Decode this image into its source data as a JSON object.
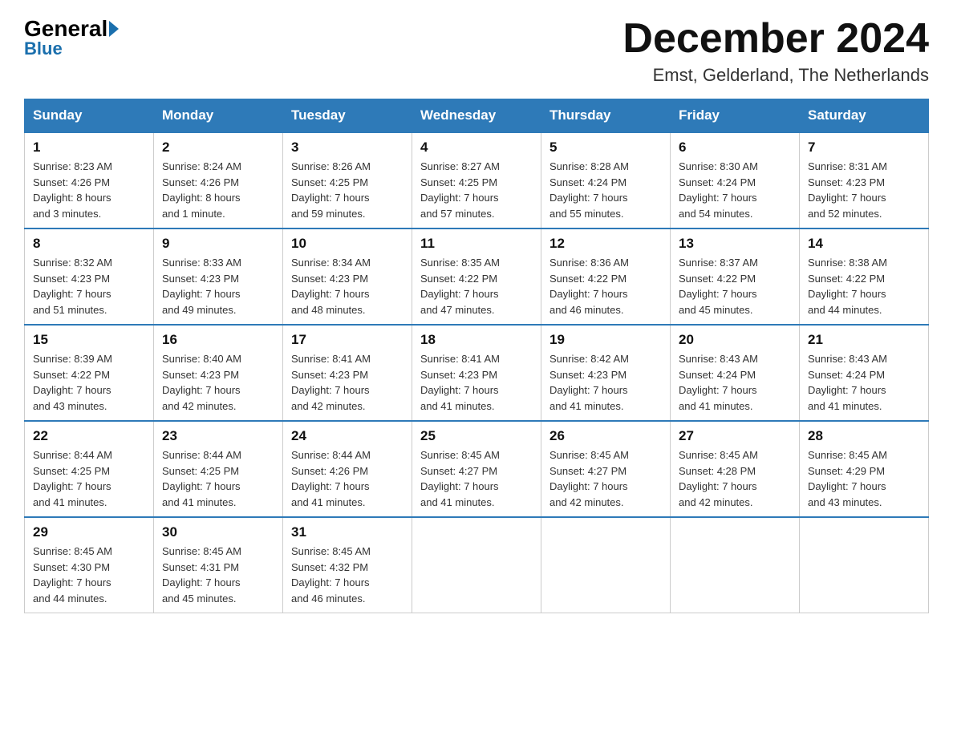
{
  "logo": {
    "general": "General",
    "blue": "Blue",
    "subtitle": "Blue"
  },
  "header": {
    "month": "December 2024",
    "location": "Emst, Gelderland, The Netherlands"
  },
  "days_of_week": [
    "Sunday",
    "Monday",
    "Tuesday",
    "Wednesday",
    "Thursday",
    "Friday",
    "Saturday"
  ],
  "weeks": [
    [
      {
        "num": "1",
        "sunrise": "8:23 AM",
        "sunset": "4:26 PM",
        "daylight": "8 hours and 3 minutes."
      },
      {
        "num": "2",
        "sunrise": "8:24 AM",
        "sunset": "4:26 PM",
        "daylight": "8 hours and 1 minute."
      },
      {
        "num": "3",
        "sunrise": "8:26 AM",
        "sunset": "4:25 PM",
        "daylight": "7 hours and 59 minutes."
      },
      {
        "num": "4",
        "sunrise": "8:27 AM",
        "sunset": "4:25 PM",
        "daylight": "7 hours and 57 minutes."
      },
      {
        "num": "5",
        "sunrise": "8:28 AM",
        "sunset": "4:24 PM",
        "daylight": "7 hours and 55 minutes."
      },
      {
        "num": "6",
        "sunrise": "8:30 AM",
        "sunset": "4:24 PM",
        "daylight": "7 hours and 54 minutes."
      },
      {
        "num": "7",
        "sunrise": "8:31 AM",
        "sunset": "4:23 PM",
        "daylight": "7 hours and 52 minutes."
      }
    ],
    [
      {
        "num": "8",
        "sunrise": "8:32 AM",
        "sunset": "4:23 PM",
        "daylight": "7 hours and 51 minutes."
      },
      {
        "num": "9",
        "sunrise": "8:33 AM",
        "sunset": "4:23 PM",
        "daylight": "7 hours and 49 minutes."
      },
      {
        "num": "10",
        "sunrise": "8:34 AM",
        "sunset": "4:23 PM",
        "daylight": "7 hours and 48 minutes."
      },
      {
        "num": "11",
        "sunrise": "8:35 AM",
        "sunset": "4:22 PM",
        "daylight": "7 hours and 47 minutes."
      },
      {
        "num": "12",
        "sunrise": "8:36 AM",
        "sunset": "4:22 PM",
        "daylight": "7 hours and 46 minutes."
      },
      {
        "num": "13",
        "sunrise": "8:37 AM",
        "sunset": "4:22 PM",
        "daylight": "7 hours and 45 minutes."
      },
      {
        "num": "14",
        "sunrise": "8:38 AM",
        "sunset": "4:22 PM",
        "daylight": "7 hours and 44 minutes."
      }
    ],
    [
      {
        "num": "15",
        "sunrise": "8:39 AM",
        "sunset": "4:22 PM",
        "daylight": "7 hours and 43 minutes."
      },
      {
        "num": "16",
        "sunrise": "8:40 AM",
        "sunset": "4:23 PM",
        "daylight": "7 hours and 42 minutes."
      },
      {
        "num": "17",
        "sunrise": "8:41 AM",
        "sunset": "4:23 PM",
        "daylight": "7 hours and 42 minutes."
      },
      {
        "num": "18",
        "sunrise": "8:41 AM",
        "sunset": "4:23 PM",
        "daylight": "7 hours and 41 minutes."
      },
      {
        "num": "19",
        "sunrise": "8:42 AM",
        "sunset": "4:23 PM",
        "daylight": "7 hours and 41 minutes."
      },
      {
        "num": "20",
        "sunrise": "8:43 AM",
        "sunset": "4:24 PM",
        "daylight": "7 hours and 41 minutes."
      },
      {
        "num": "21",
        "sunrise": "8:43 AM",
        "sunset": "4:24 PM",
        "daylight": "7 hours and 41 minutes."
      }
    ],
    [
      {
        "num": "22",
        "sunrise": "8:44 AM",
        "sunset": "4:25 PM",
        "daylight": "7 hours and 41 minutes."
      },
      {
        "num": "23",
        "sunrise": "8:44 AM",
        "sunset": "4:25 PM",
        "daylight": "7 hours and 41 minutes."
      },
      {
        "num": "24",
        "sunrise": "8:44 AM",
        "sunset": "4:26 PM",
        "daylight": "7 hours and 41 minutes."
      },
      {
        "num": "25",
        "sunrise": "8:45 AM",
        "sunset": "4:27 PM",
        "daylight": "7 hours and 41 minutes."
      },
      {
        "num": "26",
        "sunrise": "8:45 AM",
        "sunset": "4:27 PM",
        "daylight": "7 hours and 42 minutes."
      },
      {
        "num": "27",
        "sunrise": "8:45 AM",
        "sunset": "4:28 PM",
        "daylight": "7 hours and 42 minutes."
      },
      {
        "num": "28",
        "sunrise": "8:45 AM",
        "sunset": "4:29 PM",
        "daylight": "7 hours and 43 minutes."
      }
    ],
    [
      {
        "num": "29",
        "sunrise": "8:45 AM",
        "sunset": "4:30 PM",
        "daylight": "7 hours and 44 minutes."
      },
      {
        "num": "30",
        "sunrise": "8:45 AM",
        "sunset": "4:31 PM",
        "daylight": "7 hours and 45 minutes."
      },
      {
        "num": "31",
        "sunrise": "8:45 AM",
        "sunset": "4:32 PM",
        "daylight": "7 hours and 46 minutes."
      },
      null,
      null,
      null,
      null
    ]
  ],
  "labels": {
    "sunrise": "Sunrise:",
    "sunset": "Sunset:",
    "daylight": "Daylight:"
  }
}
